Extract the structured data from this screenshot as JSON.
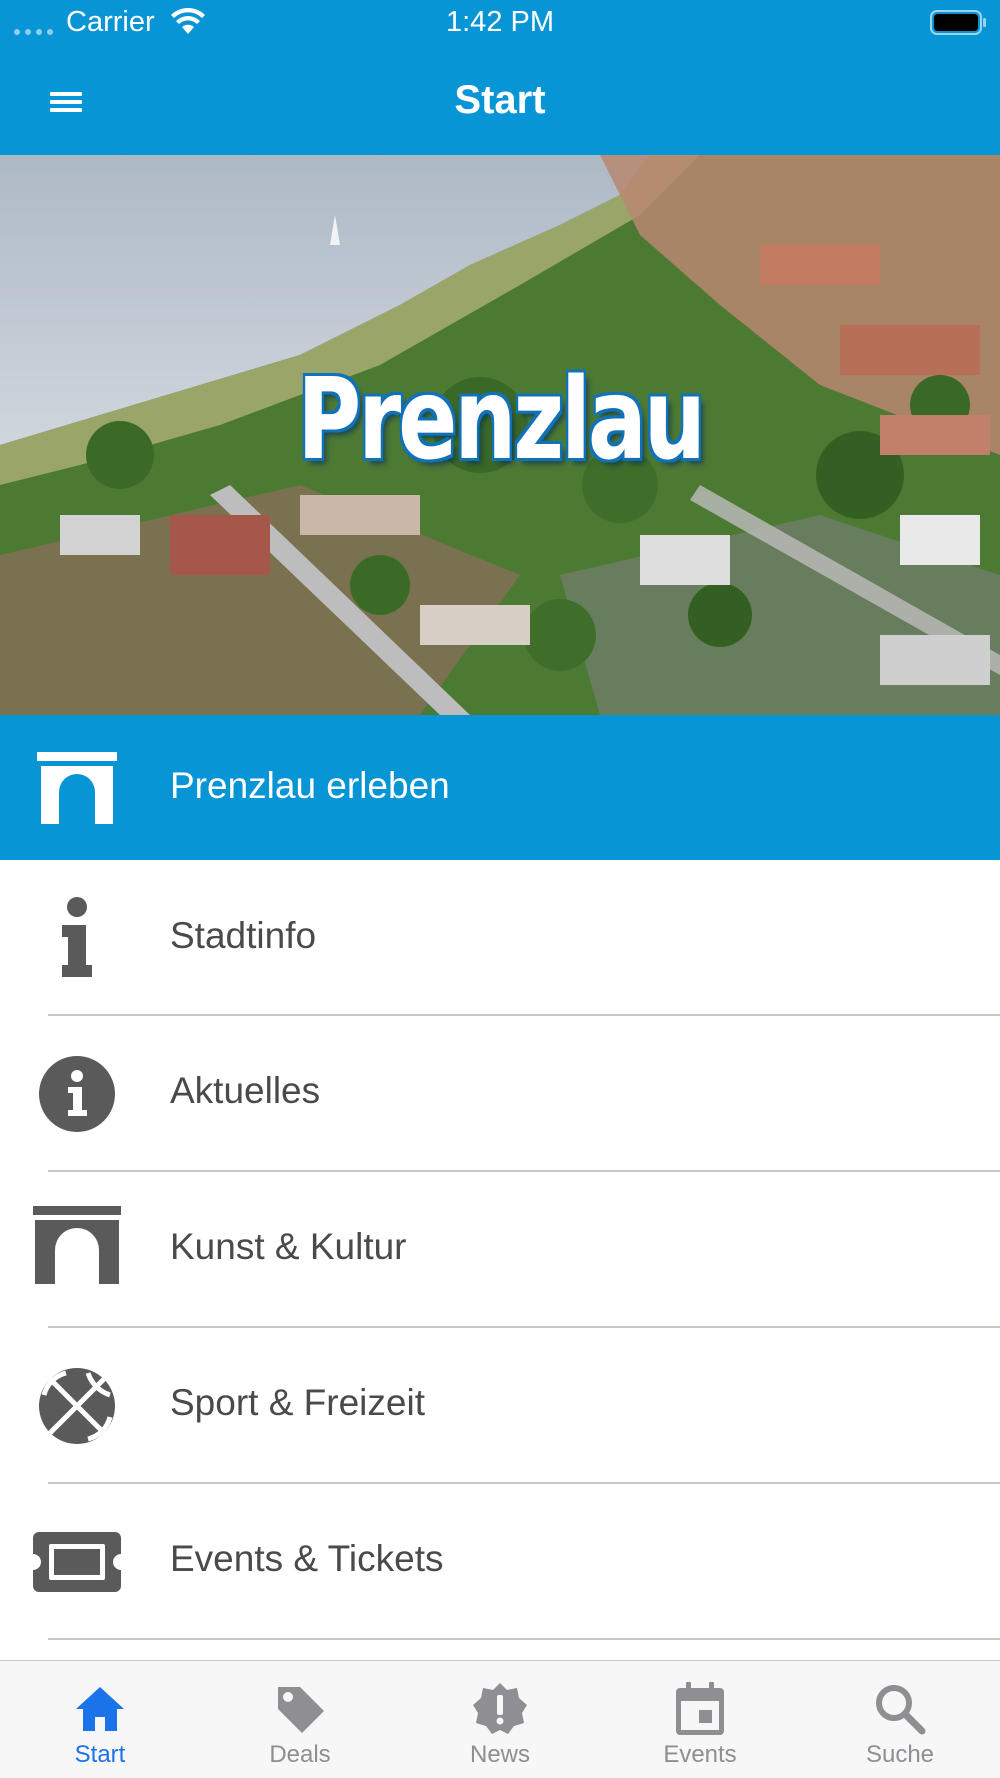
{
  "status_bar": {
    "carrier": "Carrier",
    "time": "1:42 PM"
  },
  "nav": {
    "title": "Start"
  },
  "hero": {
    "title": "Prenzlau"
  },
  "menu": [
    {
      "label": "Prenzlau erleben",
      "icon": "gate-icon"
    },
    {
      "label": "Stadtinfo",
      "icon": "info-icon"
    },
    {
      "label": "Aktuelles",
      "icon": "info-circle-icon"
    },
    {
      "label": "Kunst & Kultur",
      "icon": "gate-icon"
    },
    {
      "label": "Sport & Freizeit",
      "icon": "basketball-icon"
    },
    {
      "label": "Events & Tickets",
      "icon": "ticket-icon"
    }
  ],
  "tabs": [
    {
      "label": "Start",
      "icon": "home-icon",
      "active": true
    },
    {
      "label": "Deals",
      "icon": "tag-icon"
    },
    {
      "label": "News",
      "icon": "alert-badge-icon"
    },
    {
      "label": "Events",
      "icon": "calendar-icon"
    },
    {
      "label": "Suche",
      "icon": "search-icon"
    }
  ],
  "colors": {
    "brand": "#0895d6",
    "active_tab": "#1a73e8",
    "text": "#4a4a4a",
    "icon": "#5a5a5a"
  }
}
